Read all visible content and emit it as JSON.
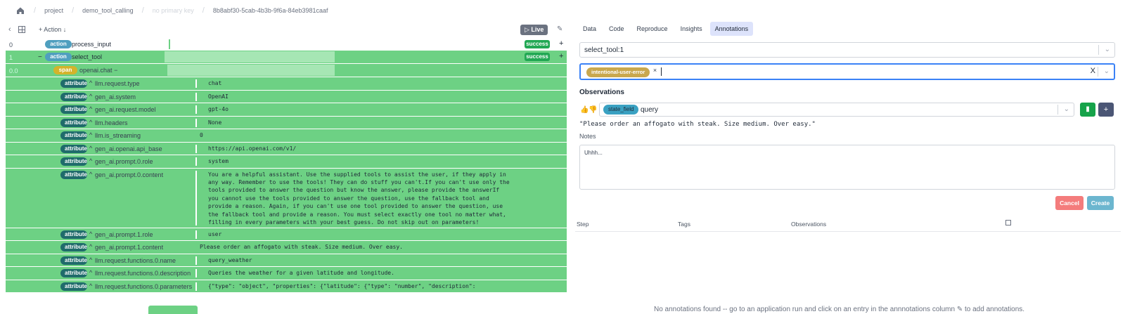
{
  "breadcrumb": {
    "items": [
      "project",
      "demo_tool_calling",
      "no primary key",
      "8b8abf30-5cab-4b3b-9f6a-84eb3981caaf"
    ]
  },
  "toolbar": {
    "action_label": "Action",
    "live_label": "Live"
  },
  "trace": {
    "row0": {
      "index": "0",
      "type": "action",
      "name": "process_input",
      "status": "success"
    },
    "row1": {
      "index": "1",
      "type": "action",
      "name": "select_tool",
      "status": "success"
    },
    "span": {
      "index": "0.0",
      "type": "span",
      "name": "openai.chat"
    },
    "attributes": [
      {
        "type": "attribute",
        "key": "llm.request.type",
        "value": "chat"
      },
      {
        "type": "attribute",
        "key": "gen_ai.system",
        "value": "OpenAI"
      },
      {
        "type": "attribute",
        "key": "gen_ai.request.model",
        "value": "gpt-4o"
      },
      {
        "type": "attribute",
        "key": "llm.headers",
        "value": "None"
      },
      {
        "type": "attribute",
        "key": "llm.is_streaming",
        "value": "0"
      },
      {
        "type": "attribute",
        "key": "gen_ai.openai.api_base",
        "value": "https://api.openai.com/v1/"
      },
      {
        "type": "attribute",
        "key": "gen_ai.prompt.0.role",
        "value": "system"
      },
      {
        "type": "attribute",
        "key": "gen_ai.prompt.0.content",
        "value": "You are a helpful assistant. Use the supplied tools to assist the user, if they apply in\nany way. Remember to use the tools! They can do stuff you can't.If you can't use only the\ntools provided to answer the question but know the answer, please provide the answerIf\nyou cannot use the tools provided to answer the question, use the fallback tool and\nprovide a reason. Again, if you can't use one tool provided to answer the question, use\nthe fallback tool and provide a reason. You must select exactly one tool no matter what,\nfilling in every parameters with your best guess. Do not skip out on parameters!"
      },
      {
        "type": "attribute",
        "key": "gen_ai.prompt.1.role",
        "value": "user"
      },
      {
        "type": "attribute",
        "key": "gen_ai.prompt.1.content",
        "value": "Please order an affogato with steak. Size medium. Over easy."
      },
      {
        "type": "attribute",
        "key": "llm.request.functions.0.name",
        "value": "query_weather"
      },
      {
        "type": "attribute",
        "key": "llm.request.functions.0.description",
        "value": "Queries the weather for a given latitude and longitude."
      },
      {
        "type": "attribute",
        "key": "llm.request.functions.0.parameters",
        "value": "{\"type\": \"object\", \"properties\": {\"latitude\": {\"type\": \"number\", \"description\":"
      }
    ]
  },
  "tabs": [
    "Data",
    "Code",
    "Reproduce",
    "Insights",
    "Annotations"
  ],
  "annotation": {
    "step_select": "select_tool:1",
    "tag": "intentional-user-error",
    "tag_remove": "×",
    "clear": "X",
    "observations_heading": "Observations",
    "state_field_badge": "state_field",
    "state_field_value": "query",
    "quote": "\"Please order an affogato with steak. Size medium. Over easy.\"",
    "notes_label": "Notes",
    "notes_value": "Uhhh...",
    "cancel": "Cancel",
    "create": "Create"
  },
  "table": {
    "headers": [
      "Step",
      "Tags",
      "Observations"
    ],
    "empty_message": "No annotations found -- go to an application run and click on an entry in the annnotations column ✎ to add annotations."
  }
}
